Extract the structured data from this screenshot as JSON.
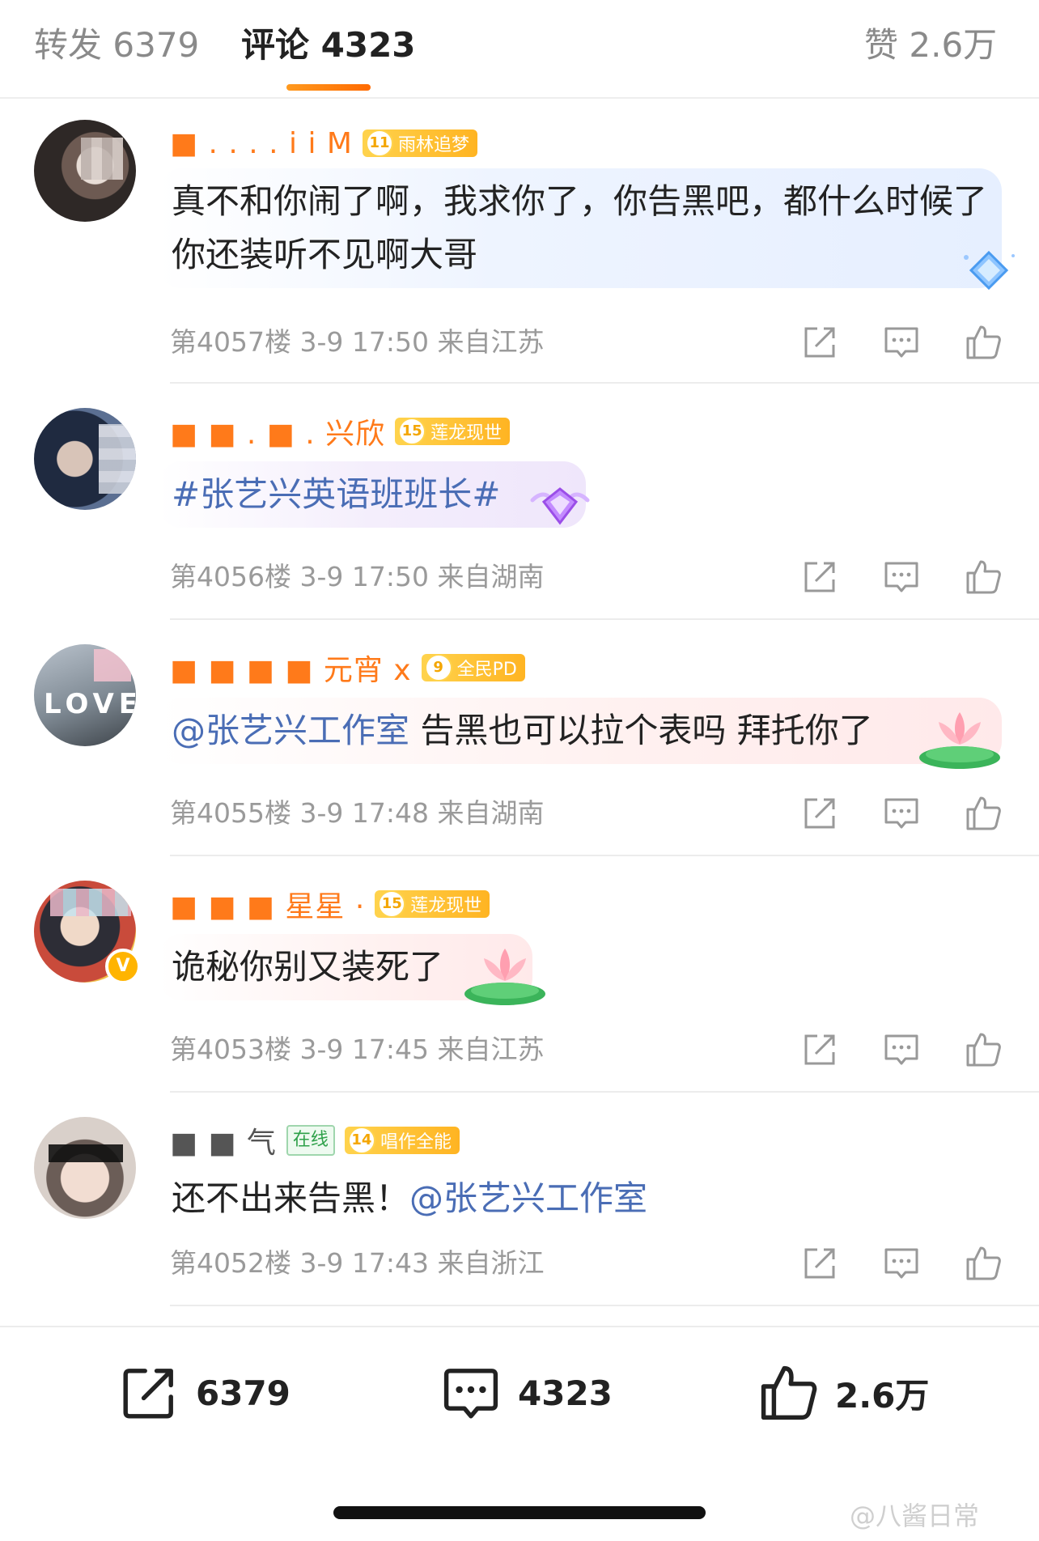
{
  "tabs": {
    "repost": {
      "label": "转发",
      "count": "6379"
    },
    "comments": {
      "label": "评论",
      "count": "4323"
    },
    "likes": {
      "label": "赞",
      "count": "2.6万"
    }
  },
  "comments": [
    {
      "username": "■ . . . . i i M",
      "badge_level": "11",
      "badge_label": "雨林追梦",
      "text": "真不和你闹了啊，我求你了，你告黑吧，都什么时候了你还装听不见啊大哥",
      "floor": "第4057楼",
      "time": "3-9 17:50",
      "location": "来自江苏",
      "deco_icon": "diamond-sparkle-icon"
    },
    {
      "username": "■ ■ . ■ . 兴欣",
      "badge_level": "15",
      "badge_label": "莲龙现世",
      "text_prefix": "",
      "text_mention": "#张艺兴英语班班长#",
      "text_rest": "",
      "floor": "第4056楼",
      "time": "3-9 17:50",
      "location": "来自湖南",
      "deco_icon": "purple-gem-icon"
    },
    {
      "username": "■ ■ ■ ■ 元宵 x",
      "badge_level": "9",
      "badge_label": "全民PD",
      "text_mention": "@张艺兴工作室",
      "text_rest": " 告黑也可以拉个表吗 拜托你了",
      "floor": "第4055楼",
      "time": "3-9 17:48",
      "location": "来自湖南",
      "deco_icon": "lotus-icon"
    },
    {
      "username": "■ ■ ■ 星星 ·",
      "badge_level": "15",
      "badge_label": "莲龙现世",
      "text": "诡秘你别又装死了",
      "floor": "第4053楼",
      "time": "3-9 17:45",
      "location": "来自江苏",
      "deco_icon": "lotus-icon",
      "verified": "V"
    },
    {
      "username": "■ ■ 气",
      "online_tag": "在线",
      "badge_level": "14",
      "badge_label": "唱作全能",
      "text_prefix": "还不出来告黑！",
      "text_mention": "@张艺兴工作室",
      "floor": "第4052楼",
      "time": "3-9 17:43",
      "location": "来自浙江"
    }
  ],
  "bottom_bar": {
    "repost_count": "6379",
    "comment_count": "4323",
    "like_count": "2.6万"
  },
  "watermark": "@八酱日常",
  "colors": {
    "accent": "#ff7a1a",
    "mention": "#4a6db5",
    "meta": "#9a9a9a",
    "badge": "#ffc233"
  }
}
